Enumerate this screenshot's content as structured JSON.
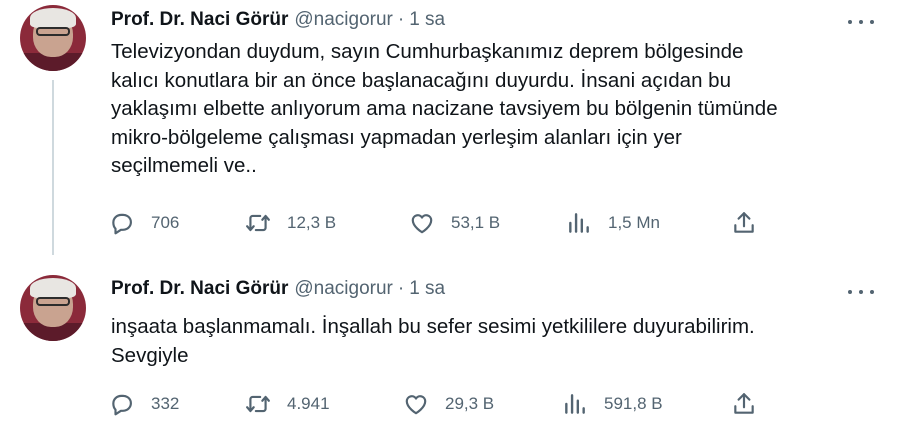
{
  "tweets": [
    {
      "author_name": "Prof. Dr. Naci Görür",
      "handle": "@nacigorur",
      "separator": "·",
      "time": "1 sa",
      "text": "Televizyondan duydum, sayın Cumhurbaşkanımız deprem bölgesinde\nkalıcı konutlara bir an önce başlanacağını duyurdu. İnsani açıdan bu\nyaklaşımı elbette anlıyorum ama nacizane tavsiyem bu bölgenin tümünde\nmikro-bölgeleme çalışması yapmadan yerleşim alanları için yer\nseçilmemeli ve..",
      "replies": "706",
      "retweets": "12,3 B",
      "likes": "53,1 B",
      "views": "1,5 Mn"
    },
    {
      "author_name": "Prof. Dr. Naci Görür",
      "handle": "@nacigorur",
      "separator": "·",
      "time": "1 sa",
      "text": "inşaata başlanmamalı. İnşallah bu sefer sesimi yetkililere duyurabilirim.\nSevgiyle",
      "replies": "332",
      "retweets": "4.941",
      "likes": "29,3 B",
      "views": "591,8 B"
    }
  ],
  "icons": {
    "reply": "reply-icon",
    "retweet": "retweet-icon",
    "like": "heart-icon",
    "views": "views-icon",
    "share": "share-icon",
    "more": "more-icon"
  },
  "colors": {
    "text": "#0f1419",
    "secondary": "#536471",
    "thread_line": "#cfd9de"
  }
}
